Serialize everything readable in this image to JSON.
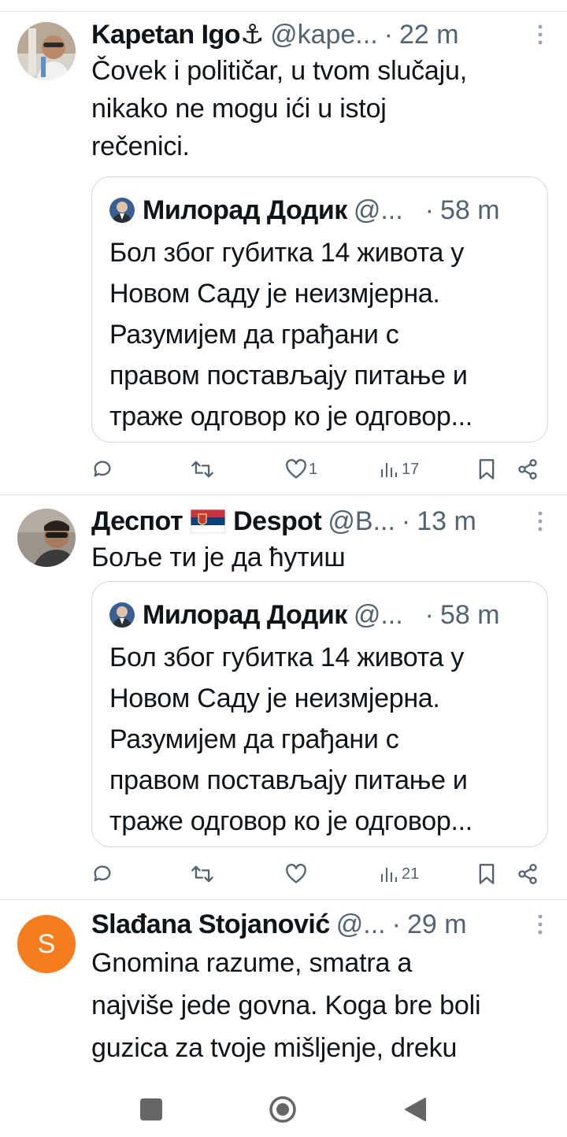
{
  "tweets": [
    {
      "author_name": "Kapetan Igo⚓",
      "handle": "@kape...",
      "separator": "·",
      "time": "22 m",
      "more_icon": "more-vertical-icon",
      "text": "Čovek i političar, u tvom slučaju,\nnikako ne mogu ići u istoj\nrečenici.",
      "quote": {
        "author_name": "Милорад Додик",
        "handle": "@...",
        "separator": "·",
        "time": "58 m",
        "text": "Бол због губитка 14 живота у\nНовом Саду је неизмјерна.\nРазумијем да грађани с\nправом постављају питање и\nтраже одговор ко је одговор..."
      },
      "actions": {
        "likes": "1",
        "views": "17"
      }
    },
    {
      "author_name": "Деспот",
      "flag": "🇷🇸",
      "author_name_2": "Despot",
      "handle": "@B...",
      "separator": "·",
      "time": "13 m",
      "text": "Боље ти је да ћутиш",
      "quote": {
        "author_name": "Милорад Додик",
        "handle": "@...",
        "separator": "·",
        "time": "58 m",
        "text": "Бол због губитка 14 живота у\nНовом Саду је неизмјерна.\nРазумијем да грађани с\nправом постављају питање и\nтраже одговор ко је одговор..."
      },
      "actions": {
        "likes": "",
        "views": "21"
      }
    },
    {
      "author_name": "Slađana Stojanović",
      "avatar_letter": "S",
      "avatar_color": "#f57c1f",
      "handle": "@...",
      "separator": "·",
      "time": "29 m",
      "text": "Gnomina razume, smatra a\nnajviše jede govna. Koga bre boli\nguzica za tvoje mišljenje, dreku"
    }
  ],
  "icons": {
    "reply": "reply-icon",
    "retweet": "retweet-icon",
    "like": "heart-icon",
    "views": "views-icon",
    "bookmark": "bookmark-icon",
    "share": "share-icon"
  },
  "system_nav": {
    "recents": "recents-square-icon",
    "home": "home-circle-icon",
    "back": "back-triangle-icon"
  },
  "colors": {
    "text": "#0f1419",
    "secondary": "#536471",
    "border": "#cfd9de",
    "divider": "#e1e4e8"
  }
}
